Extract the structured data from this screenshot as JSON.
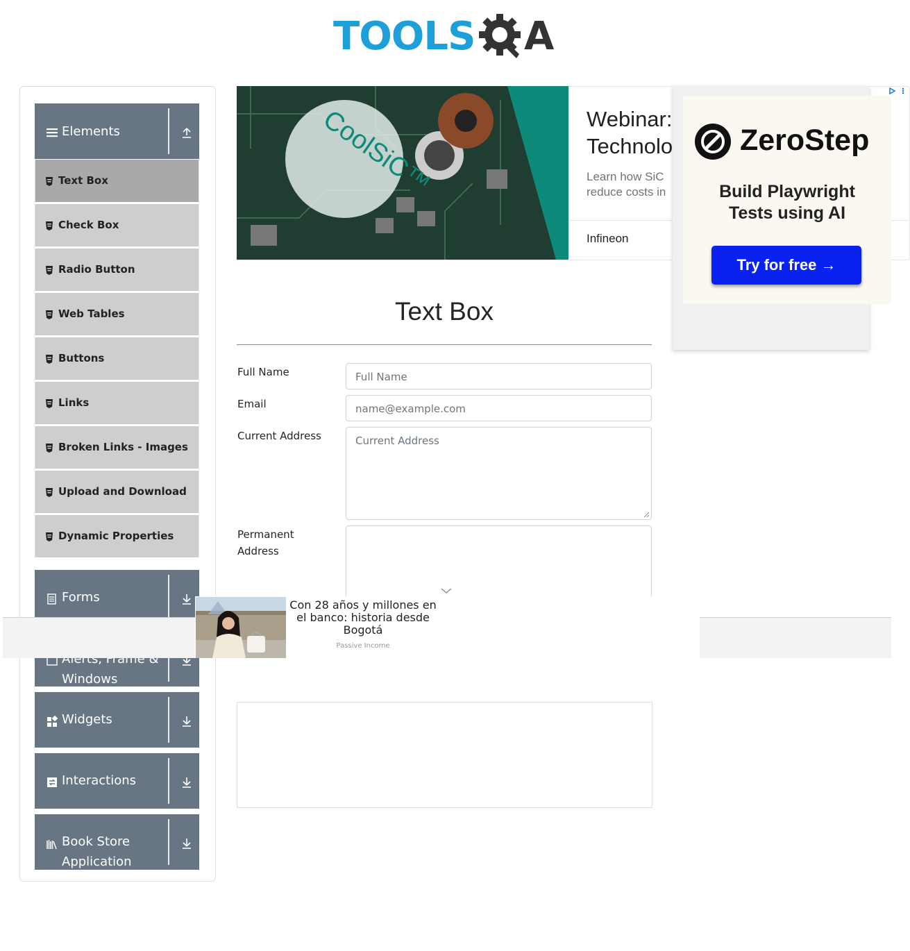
{
  "logo": {
    "text_tools": "TOOLS",
    "text_a": "A"
  },
  "sidebar": {
    "groups": [
      {
        "label": "Elements"
      },
      {
        "label": "Forms"
      },
      {
        "label": "Alerts, Frame &",
        "label2": "Windows"
      },
      {
        "label": "Widgets"
      },
      {
        "label": "Interactions"
      },
      {
        "label": "Book Store",
        "label2": "Application"
      }
    ],
    "items": [
      {
        "label": "Text Box"
      },
      {
        "label": "Check Box"
      },
      {
        "label": "Radio Button"
      },
      {
        "label": "Web Tables"
      },
      {
        "label": "Buttons"
      },
      {
        "label": "Links"
      },
      {
        "label": "Broken Links - Images"
      },
      {
        "label": "Upload and Download"
      },
      {
        "label": "Dynamic Properties"
      }
    ]
  },
  "ad_banner": {
    "image_text": "CoolSiC™",
    "title_line1": "Webinar:",
    "title_line2": "Technolog",
    "desc_line1": "Learn how SiC",
    "desc_line2": "reduce costs in",
    "advertiser": "Infineon"
  },
  "zerostep_ad": {
    "brand": "ZeroStep",
    "headline_line1": "Build Playwright",
    "headline_line2": "Tests using AI",
    "cta": "Try for free →"
  },
  "form": {
    "title": "Text Box",
    "full_name_label": "Full Name",
    "full_name_placeholder": "Full Name",
    "email_label": "Email",
    "email_placeholder": "name@example.com",
    "current_address_label": "Current Address",
    "current_address_placeholder": "Current Address",
    "permanent_address_label1": "Permanent",
    "permanent_address_label2": "Address"
  },
  "popup_ad": {
    "line1": "Con 28 años y millones en",
    "line2": "el banco: historia desde",
    "line3": "Bogotá",
    "source": "Passive Income"
  },
  "colors": {
    "group_bg": "#687583",
    "item_bg": "#cecece",
    "item_active_bg": "#a9a9a9",
    "logo_blue": "#1d9fd9",
    "logo_dark": "#333333",
    "cta_blue": "#0a22f0"
  }
}
